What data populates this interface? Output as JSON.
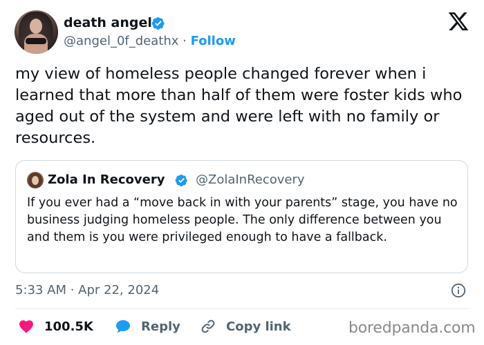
{
  "author": {
    "name": "death angel",
    "handle": "@angel_0f_deathx",
    "separator": " · ",
    "follow_label": "Follow"
  },
  "tweet": {
    "text": "my view of homeless people changed forever when i learned that more than half of them were foster kids who aged out of the system and were left with no family or resources."
  },
  "quoted": {
    "name": "Zola In Recovery",
    "handle": "@ZolaInRecovery",
    "text": "If you ever had a “move back in with your parents” stage, you have no business judging homeless people. The only difference between you and them is you were privileged enough to have a fallback."
  },
  "timestamp": "5:33 AM · Apr 22, 2024",
  "actions": {
    "likes": "100.5K",
    "reply_label": "Reply",
    "copy_label": "Copy link"
  },
  "watermark": "boredpanda.com",
  "colors": {
    "accent": "#1d9bf0",
    "like": "#f91880",
    "muted": "#536471",
    "text": "#0f1419"
  },
  "icons": {
    "verified": "verified-badge-icon",
    "logo": "x-logo-icon",
    "info": "info-icon",
    "like": "heart-icon",
    "reply": "speech-bubble-icon",
    "copy": "link-icon"
  }
}
